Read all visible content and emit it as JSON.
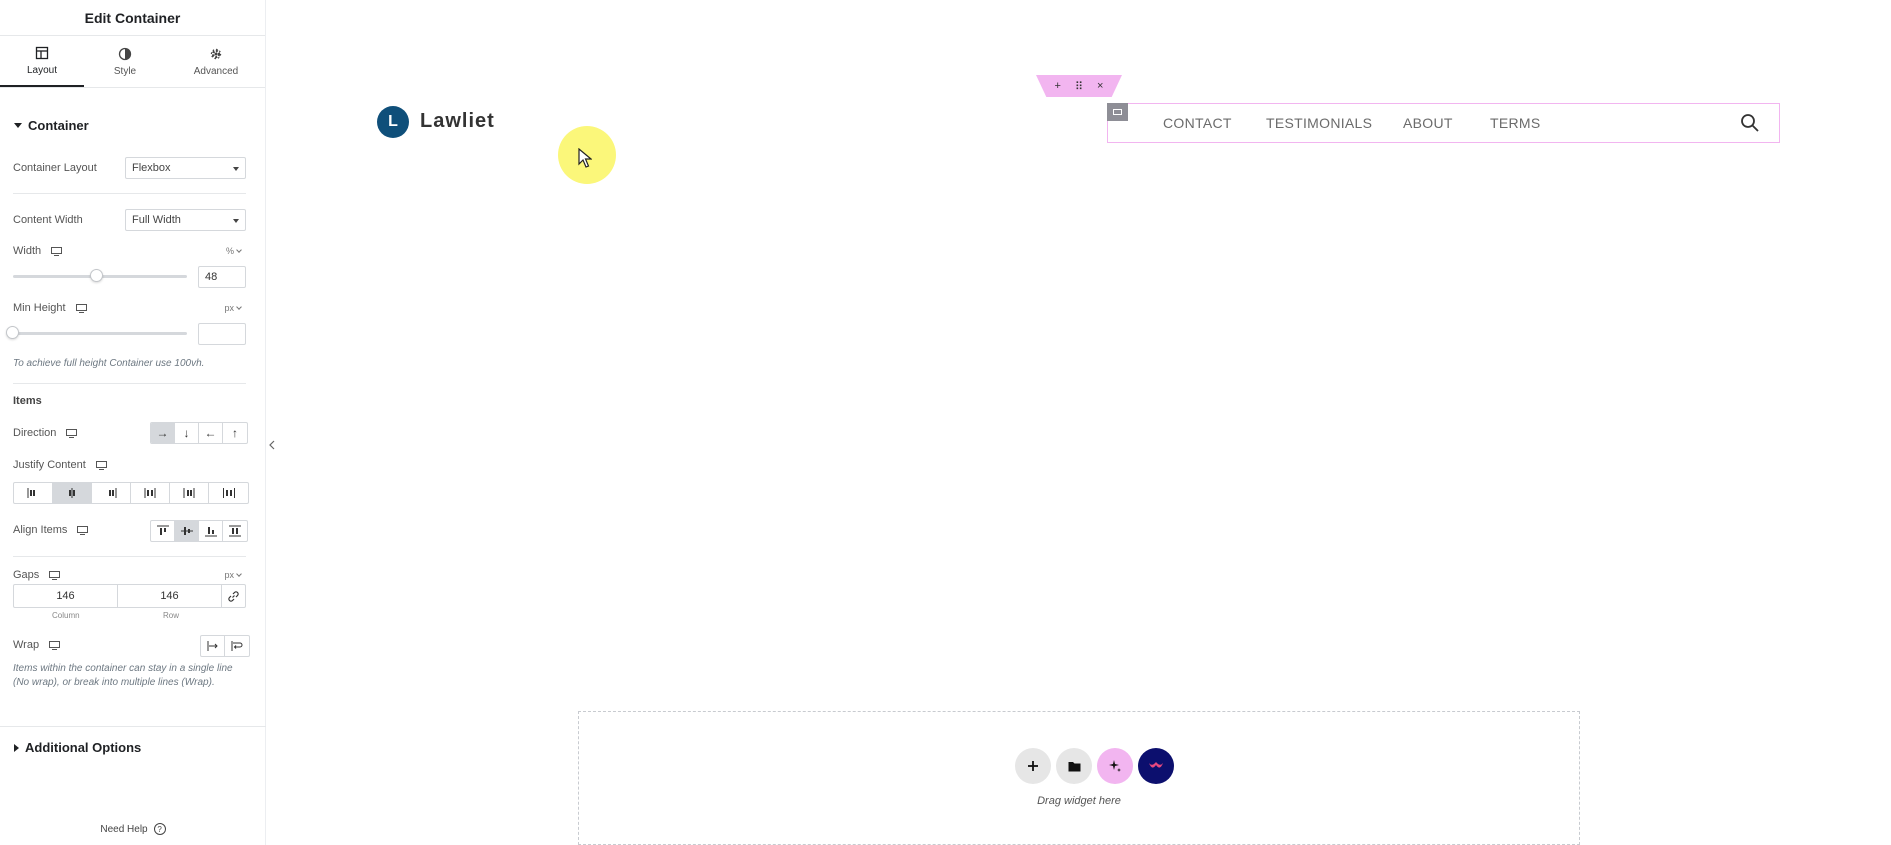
{
  "panel": {
    "title": "Edit Container",
    "tabs": [
      {
        "label": "Layout",
        "icon": "layout-icon"
      },
      {
        "label": "Style",
        "icon": "half-circle-icon"
      },
      {
        "label": "Advanced",
        "icon": "gear-icon"
      }
    ],
    "active_tab": "Layout"
  },
  "container_section": {
    "title": "Container",
    "layout_label": "Container Layout",
    "layout_value": "Flexbox",
    "content_width_label": "Content Width",
    "content_width_value": "Full Width",
    "width_label": "Width",
    "width_unit": "%",
    "width_value": "48",
    "width_fraction": 0.48,
    "min_height_label": "Min Height",
    "min_height_unit": "px",
    "min_height_value": "",
    "min_height_hint": "To achieve full height Container use 100vh."
  },
  "items_section": {
    "title": "Items",
    "direction_label": "Direction",
    "direction_options": [
      "→",
      "↓",
      "←",
      "↑"
    ],
    "direction_selected": 0,
    "justify_label": "Justify Content",
    "justify_selected": 1,
    "align_label": "Align Items",
    "align_selected": 1,
    "gaps_label": "Gaps",
    "gaps_unit": "px",
    "gap_column": "146",
    "gap_row": "146",
    "gap_column_caption": "Column",
    "gap_row_caption": "Row",
    "wrap_label": "Wrap",
    "wrap_hint": "Items within the container can stay in a single line (No wrap), or break into multiple lines (Wrap)."
  },
  "additional": {
    "title": "Additional Options"
  },
  "help": {
    "label": "Need Help",
    "icon": "help-circle-icon"
  },
  "site": {
    "logo_letter": "L",
    "logo_text": "Lawliet",
    "logo_color": "#0f4f7a",
    "nav_items": [
      "CONTACT",
      "TESTIMONIALS",
      "ABOUT",
      "TERMS"
    ],
    "nav_toolbar": [
      "+",
      "⠿",
      "×"
    ],
    "accent_pink": "#f2b5f0"
  },
  "dropzone": {
    "text": "Drag widget here",
    "buttons": [
      {
        "icon": "plus-icon",
        "bg": "#e6e6e6"
      },
      {
        "icon": "folder-icon",
        "bg": "#e6e6e6"
      },
      {
        "icon": "sparkle-icon",
        "bg": "#f2b5f0"
      },
      {
        "icon": "brand-logo-icon",
        "bg": "#0c0f6e"
      }
    ]
  }
}
